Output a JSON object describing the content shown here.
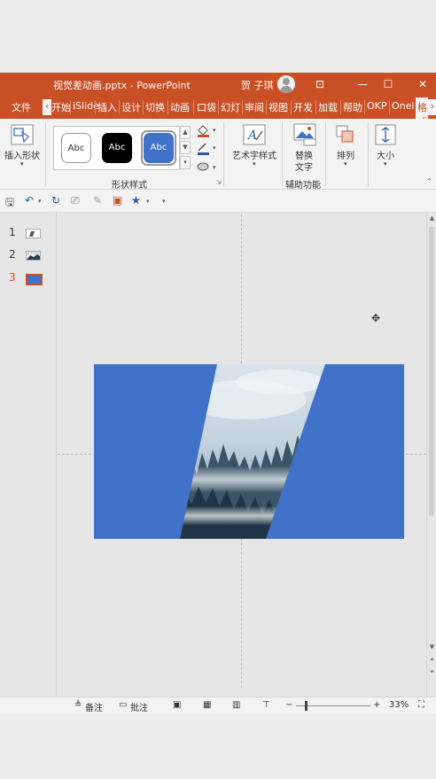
{
  "window": {
    "title": "视觉差动画.pptx  -  PowerPoint",
    "user": "贺 子琪",
    "controls": {
      "restore_ribbon": "⊡",
      "minimize": "—",
      "maximize": "☐",
      "close": "✕"
    }
  },
  "tabs": [
    "文件",
    "开始",
    "iSlide",
    "插入",
    "设计",
    "切换",
    "动画",
    "口袋",
    "幻灯",
    "审阅",
    "视图",
    "开发",
    "加载",
    "帮助",
    "OKP",
    "Onel",
    "格式"
  ],
  "ribbon": {
    "insert_shape": {
      "label": "插入形状"
    },
    "shape_styles": {
      "group_label": "形状样式",
      "samples": [
        "Abc",
        "Abc",
        "Abc"
      ]
    },
    "wordart": {
      "label": "艺术字样式"
    },
    "accessibility": {
      "label1": "替换",
      "label2": "文字",
      "group_label": "辅助功能"
    },
    "arrange": {
      "label": "排列"
    },
    "size": {
      "label": "大小"
    }
  },
  "thumbnails": [
    {
      "number": "1",
      "active": false
    },
    {
      "number": "2",
      "active": false
    },
    {
      "number": "3",
      "active": true
    }
  ],
  "statusbar": {
    "notes": "备注",
    "comments": "批注",
    "zoom_minus": "−",
    "zoom_plus": "+",
    "zoom": "33%"
  },
  "colors": {
    "accent": "#c94f25",
    "slide_fill": "#3f72c8",
    "ribbon_bg": "#f3f3f3"
  }
}
